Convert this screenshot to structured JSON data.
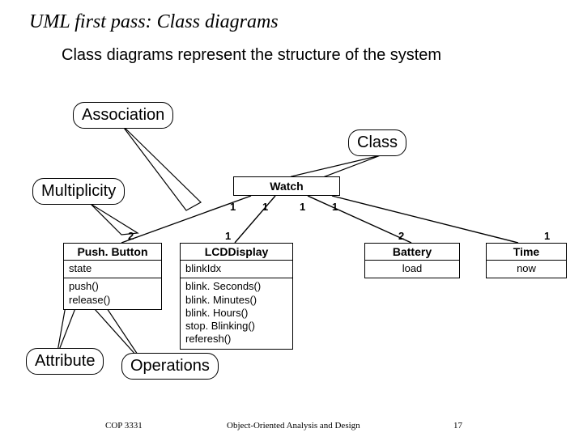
{
  "title": "UML first pass: Class diagrams",
  "subtitle": "Class diagrams represent the structure of the system",
  "callouts": {
    "association": "Association",
    "class": "Class",
    "multiplicity": "Multiplicity",
    "attribute": "Attribute",
    "operations": "Operations"
  },
  "classes": {
    "watch": {
      "name": "Watch"
    },
    "pushbutton": {
      "name": "Push. Button",
      "attrs": [
        "state"
      ],
      "ops": [
        "push()",
        "release()"
      ]
    },
    "lcd": {
      "name": "LCDDisplay",
      "attrs": [
        "blinkIdx"
      ],
      "ops": [
        "blink. Seconds()",
        "blink. Minutes()",
        "blink. Hours()",
        "stop. Blinking()",
        "referesh()"
      ]
    },
    "battery": {
      "name": "Battery",
      "attrs": [
        "load"
      ]
    },
    "time": {
      "name": "Time",
      "attrs": [
        "now"
      ]
    }
  },
  "multiplicities": {
    "watch_pb_top": "1",
    "watch_lcd_top": "1",
    "watch_bat_top": "1",
    "watch_time_top": "1",
    "pb_bottom": "2",
    "lcd_bottom": "1",
    "bat_bottom": "2",
    "time_bottom": "1"
  },
  "footer": {
    "left": "COP 3331",
    "center": "Object-Oriented Analysis and Design",
    "right": "17"
  }
}
